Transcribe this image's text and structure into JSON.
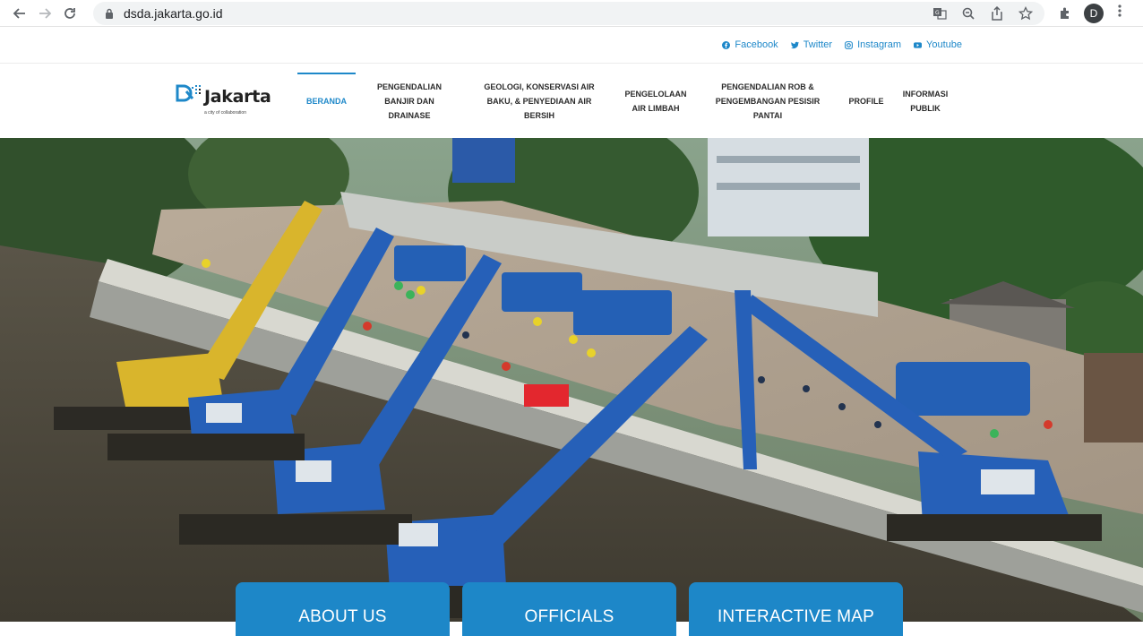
{
  "browser": {
    "url": "dsda.jakarta.go.id",
    "avatar_letter": "D",
    "icons": [
      "back-icon",
      "forward-icon",
      "reload-icon",
      "lock-icon",
      "translate-icon",
      "zoom-icon",
      "share-icon",
      "bookmark-star-icon",
      "extensions-icon",
      "menu-kebab-icon"
    ]
  },
  "social": {
    "links": [
      {
        "label": "Facebook",
        "icon": "facebook-icon"
      },
      {
        "label": "Twitter",
        "icon": "twitter-icon"
      },
      {
        "label": "Instagram",
        "icon": "instagram-icon"
      },
      {
        "label": "Youtube",
        "icon": "youtube-icon"
      }
    ]
  },
  "logo": {
    "word": "Jakarta",
    "tagline": "a city of collaboration"
  },
  "nav": {
    "items": [
      {
        "label": "BERANDA",
        "active": true
      },
      {
        "label": "PENGENDALIAN BANJIR DAN DRAINASE",
        "active": false
      },
      {
        "label": "GEOLOGI, KONSERVASI AIR BAKU, & PENYEDIAAN AIR BERSIH",
        "active": false
      },
      {
        "label": "PENGELOLAAN AIR LIMBAH",
        "active": false
      },
      {
        "label": "PENGENDALIAN ROB & PENGEMBANGAN PESISIR PANTAI",
        "active": false
      },
      {
        "label": "PROFILE",
        "active": false
      },
      {
        "label": "INFORMASI PUBLIK",
        "active": false
      }
    ],
    "active_color": "#1e88c9"
  },
  "cards": [
    {
      "label": "ABOUT US"
    },
    {
      "label": "OFFICIALS"
    },
    {
      "label": "INTERACTIVE MAP"
    }
  ],
  "colors": {
    "brand_blue": "#1e88c9",
    "card_blue": "#1d87c8"
  }
}
